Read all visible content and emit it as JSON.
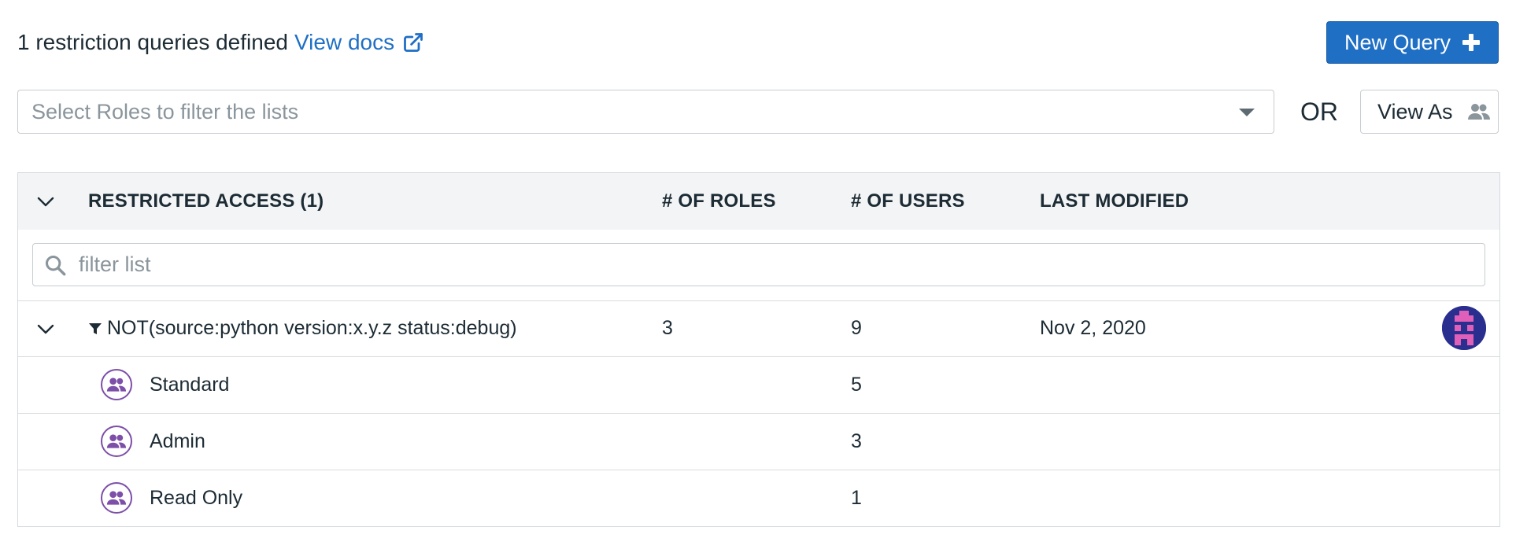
{
  "header": {
    "summary": "1 restriction queries defined",
    "docs_link": "View docs",
    "docs_icon": "external-link-icon",
    "new_query_label": "New Query",
    "new_query_icon": "plus-icon"
  },
  "filters": {
    "roles_placeholder": "Select Roles to filter the lists",
    "or_label": "OR",
    "view_as_label": "View As",
    "view_as_icon": "users-icon"
  },
  "table": {
    "columns": {
      "restricted_access": "RESTRICTED ACCESS (1)",
      "num_roles": "# OF ROLES",
      "num_users": "# OF USERS",
      "last_modified": "LAST MODIFIED"
    },
    "filter_placeholder": "filter list",
    "query": {
      "text": "NOT(source:python version:x.y.z status:debug)",
      "roles": "3",
      "users": "9",
      "last_modified": "Nov 2, 2020"
    },
    "roles": [
      {
        "name": "Standard",
        "users": "5"
      },
      {
        "name": "Admin",
        "users": "3"
      },
      {
        "name": "Read Only",
        "users": "1"
      }
    ]
  },
  "colors": {
    "primary": "#1f6fc5",
    "role_icon": "#7d4fa8",
    "avatar_bg": "#2a2f8f",
    "avatar_fg": "#e05fb8"
  }
}
